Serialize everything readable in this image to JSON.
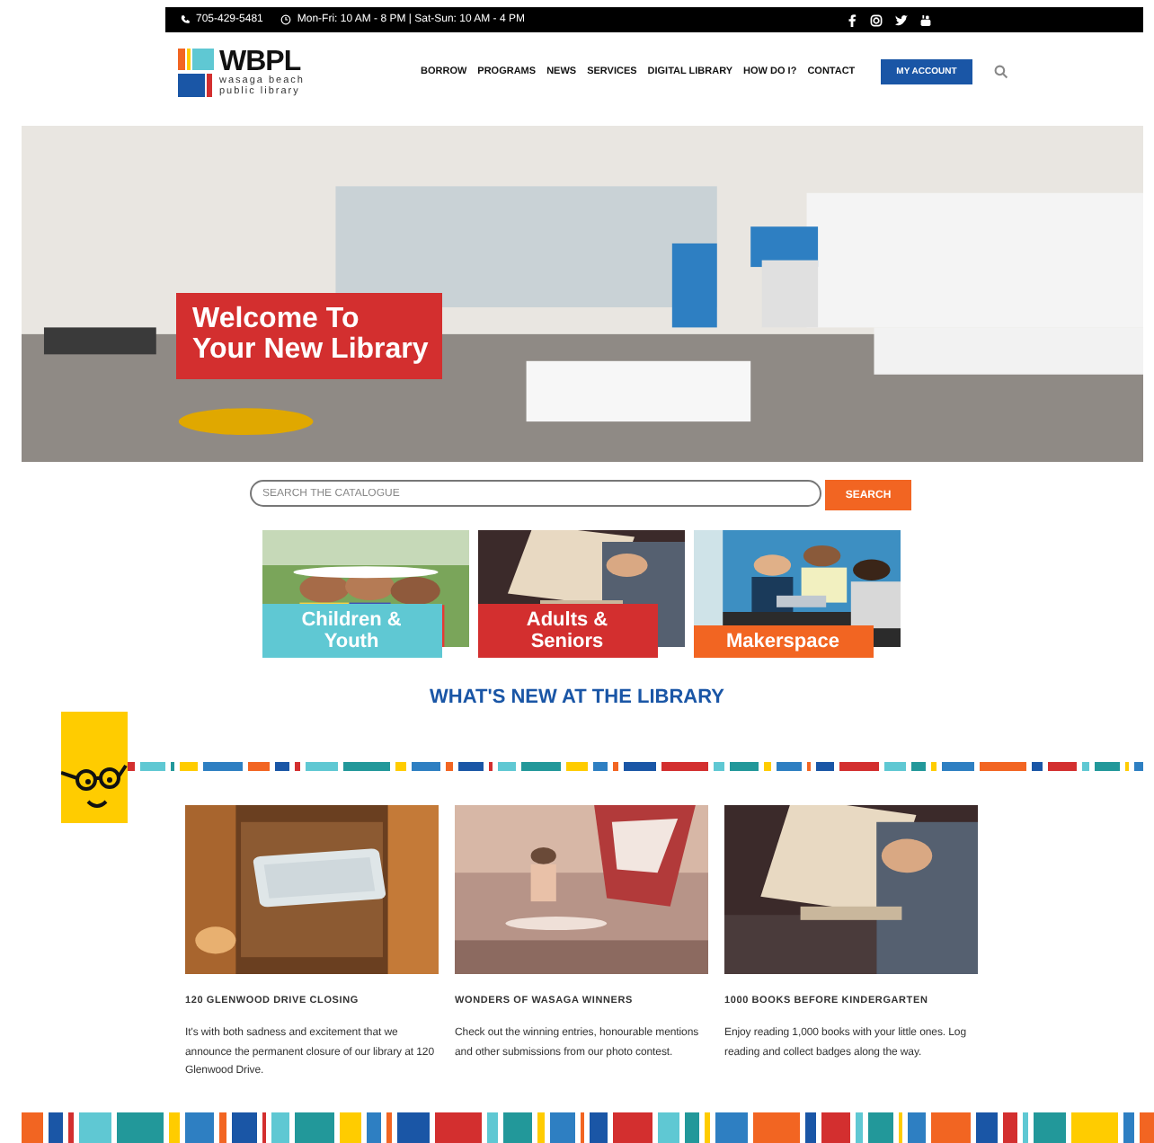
{
  "top_bar": {
    "phone": "705-429-5481",
    "hours": "Mon-Fri: 10 AM - 8 PM | Sat-Sun: 10 AM - 4 PM"
  },
  "logo": {
    "name": "WBPL",
    "tagline_1": "wasaga beach",
    "tagline_2": "public library"
  },
  "nav": {
    "items": [
      "BORROW",
      "PROGRAMS",
      "NEWS",
      "SERVICES",
      "DIGITAL LIBRARY",
      "HOW DO I?",
      "CONTACT"
    ],
    "account_button": "MY ACCOUNT"
  },
  "hero": {
    "kind": "picture",
    "headline_1": "Welcome To",
    "headline_2": "Your New Library"
  },
  "catalogue_search": {
    "placeholder": "SEARCH THE CATALOGUE",
    "button": "SEARCH"
  },
  "tiles": [
    {
      "label_1": "Children &",
      "label_2": "Youth",
      "color": "#5fc8d3",
      "kind": "picture"
    },
    {
      "label_1": "Adults &",
      "label_2": "Seniors",
      "color": "#d32f2f",
      "kind": "picture"
    },
    {
      "label_1": "Makerspace",
      "color": "#f26522",
      "kind": "picture"
    }
  ],
  "news": {
    "heading": "WHAT'S NEW AT THE LIBRARY",
    "cards": [
      {
        "kind": "picture",
        "title": "120 GLENWOOD DRIVE CLOSING",
        "text": "It's with both sadness and excitement that we announce the permanent closure of our library at 120 Glenwood Drive."
      },
      {
        "kind": "picture",
        "title": "WONDERS OF WASAGA WINNERS",
        "text": "Check out the winning entries, honourable mentions and other submissions from our photo contest."
      },
      {
        "kind": "picture",
        "title": "1000 BOOKS BEFORE KINDERGARTEN",
        "text": "Enjoy reading 1,000 books with your little ones. Log reading and collect badges along the way."
      }
    ]
  }
}
